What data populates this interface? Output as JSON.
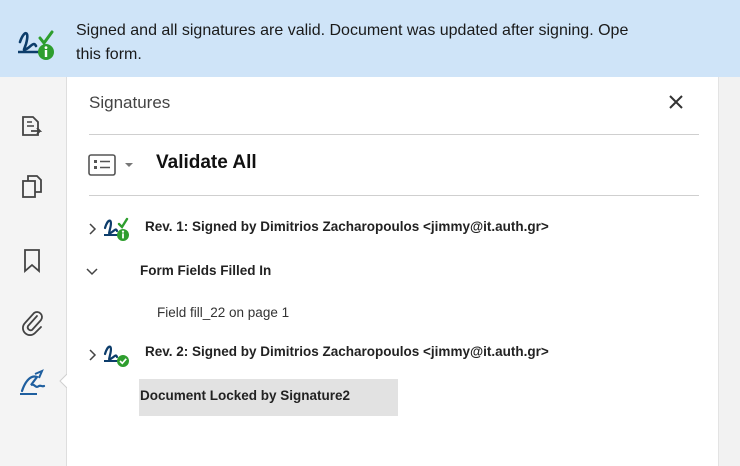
{
  "banner": {
    "message_line1": "Signed and all signatures are valid. Document was updated after signing. Ope",
    "message_line2": "this form.",
    "icon": "signature-valid-icon"
  },
  "toolrail": {
    "items": [
      {
        "icon": "export-document-icon"
      },
      {
        "icon": "pages-icon"
      },
      {
        "icon": "bookmark-icon"
      },
      {
        "icon": "attachment-icon"
      },
      {
        "icon": "signature-panel-icon",
        "active": true
      }
    ]
  },
  "panel": {
    "title": "Signatures",
    "close_icon": "close-icon",
    "validate_all": "Validate All",
    "rows": [
      {
        "label": "Rev. 1: Signed by Dimitrios Zacharopoulos <jimmy@it.auth.gr>",
        "expanded": false,
        "status": "info"
      },
      {
        "label": "Form Fields Filled In",
        "expanded": true
      },
      {
        "label": "Field fill_22 on page 1"
      },
      {
        "label": "Rev. 2: Signed by Dimitrios Zacharopoulos <jimmy@it.auth.gr>",
        "expanded": false,
        "status": "valid"
      },
      {
        "label": "Document Locked by Signature2",
        "selected": true
      }
    ]
  },
  "colors": {
    "banner_bg": "#cfe4f8",
    "valid_green": "#2e9e2e",
    "icon_blue": "#1f5f9f",
    "selection_gray": "#e2e2e2"
  }
}
